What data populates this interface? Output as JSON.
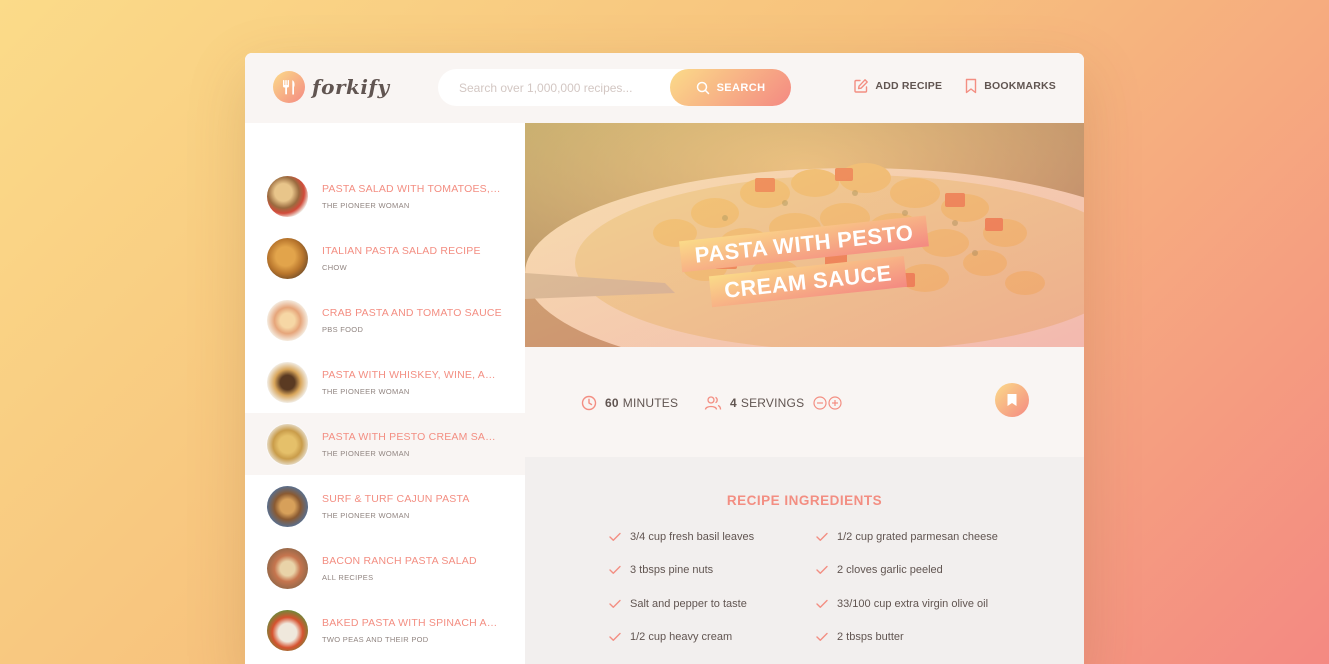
{
  "app": {
    "name": "forkify"
  },
  "search": {
    "placeholder": "Search over 1,000,000 recipes...",
    "button_label": "SEARCH"
  },
  "nav": {
    "add_recipe": "ADD RECIPE",
    "bookmarks": "BOOKMARKS"
  },
  "results": [
    {
      "title": "PASTA SALAD WITH TOMATOES, ...",
      "publisher": "THE PIONEER WOMAN",
      "active": false
    },
    {
      "title": "ITALIAN PASTA SALAD RECIPE",
      "publisher": "CHOW",
      "active": false
    },
    {
      "title": "CRAB PASTA AND TOMATO SAUCE",
      "publisher": "PBS FOOD",
      "active": false
    },
    {
      "title": "PASTA WITH WHISKEY, WINE, AN...",
      "publisher": "THE PIONEER WOMAN",
      "active": false
    },
    {
      "title": "PASTA WITH PESTO CREAM SAUCE",
      "publisher": "THE PIONEER WOMAN",
      "active": true
    },
    {
      "title": "SURF & TURF CAJUN PASTA",
      "publisher": "THE PIONEER WOMAN",
      "active": false
    },
    {
      "title": "BACON RANCH PASTA SALAD",
      "publisher": "ALL RECIPES",
      "active": false
    },
    {
      "title": "BAKED PASTA WITH SPINACH AN...",
      "publisher": "TWO PEAS AND THEIR POD",
      "active": false
    }
  ],
  "recipe": {
    "title_line1": "PASTA WITH PESTO",
    "title_line2": "CREAM SAUCE",
    "cooking_time": "60",
    "cooking_time_unit": "MINUTES",
    "servings": "4",
    "servings_unit": "SERVINGS"
  },
  "ingredients": {
    "heading": "RECIPE INGREDIENTS",
    "items": [
      "3/4 cup fresh basil leaves",
      "1/2 cup grated parmesan cheese",
      "3 tbsps pine nuts",
      "2 cloves garlic peeled",
      "Salt and pepper to taste",
      "33/100 cup extra virgin olive oil",
      "1/2 cup heavy cream",
      "2 tbsps butter"
    ]
  },
  "colors": {
    "accent": "#f38e82",
    "gradient_start": "#fbdb89",
    "gradient_end": "#f48982",
    "text": "#615551"
  },
  "icons": [
    "logo-fork-icon",
    "search-icon",
    "edit-icon",
    "bookmark-icon",
    "clock-icon",
    "users-icon",
    "minus-circle-icon",
    "plus-circle-icon",
    "check-icon"
  ]
}
